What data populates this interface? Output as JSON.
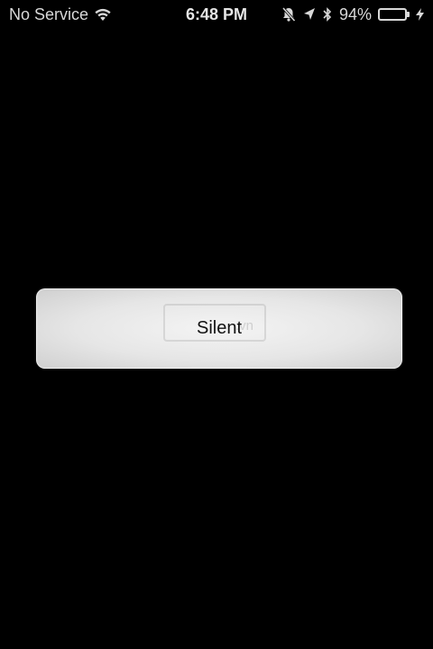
{
  "status_bar": {
    "carrier": "No Service",
    "time": "6:48 PM",
    "battery_percent_text": "94%",
    "battery_level": 0.94,
    "icons": [
      "wifi-icon",
      "silent-bell-icon",
      "location-arrow-icon",
      "bluetooth-icon",
      "battery-icon",
      "charging-bolt-icon"
    ],
    "battery_color": "#3eb54a"
  },
  "hud": {
    "label": "Silent",
    "watermark_text": ".vn"
  }
}
